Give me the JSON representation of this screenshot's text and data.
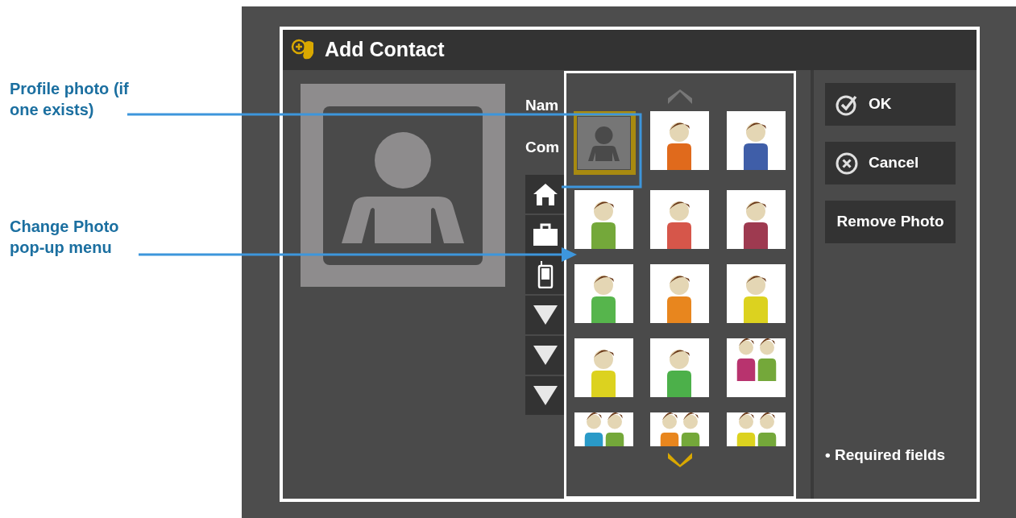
{
  "dialog": {
    "title": "Add Contact"
  },
  "form_labels": [
    "Nam",
    "Com"
  ],
  "field_buttons": [
    {
      "kind": "home"
    },
    {
      "kind": "work"
    },
    {
      "kind": "mobile"
    },
    {
      "kind": "dropdown"
    },
    {
      "kind": "dropdown"
    },
    {
      "kind": "dropdown"
    }
  ],
  "photo_menu": {
    "avatars": [
      {
        "kind": "placeholder",
        "selected": true
      },
      {
        "kind": "person",
        "selected": false,
        "color": "#e06a1c"
      },
      {
        "kind": "person",
        "selected": false,
        "color": "#3f5ea8"
      },
      {
        "kind": "person",
        "selected": false,
        "color": "#74a83a"
      },
      {
        "kind": "person",
        "selected": false,
        "color": "#d6564a"
      },
      {
        "kind": "person",
        "selected": false,
        "color": "#9e3a50"
      },
      {
        "kind": "person",
        "selected": false,
        "color": "#56b54c"
      },
      {
        "kind": "person",
        "selected": false,
        "color": "#e8861e"
      },
      {
        "kind": "person",
        "selected": false,
        "color": "#dcd21f"
      },
      {
        "kind": "person",
        "selected": false,
        "color": "#dcd21f"
      },
      {
        "kind": "person",
        "selected": false,
        "color": "#4cb04a"
      },
      {
        "kind": "pair",
        "selected": false,
        "color": "#b8336e"
      },
      {
        "kind": "pair",
        "selected": false,
        "color": "#2a9ac8"
      },
      {
        "kind": "pair",
        "selected": false,
        "color": "#e8861e"
      },
      {
        "kind": "pair",
        "selected": false,
        "color": "#dcd21f"
      }
    ]
  },
  "buttons": [
    {
      "kind": "ok",
      "label": "OK"
    },
    {
      "kind": "cancel",
      "label": "Cancel"
    },
    {
      "kind": "plain",
      "label": "Remove Photo"
    }
  ],
  "required_note": "• Required fields",
  "callouts": [
    {
      "kind": "box",
      "text": "Profile photo (if one exists)"
    },
    {
      "kind": "arrow",
      "text": "Change Photo pop-up menu"
    }
  ]
}
